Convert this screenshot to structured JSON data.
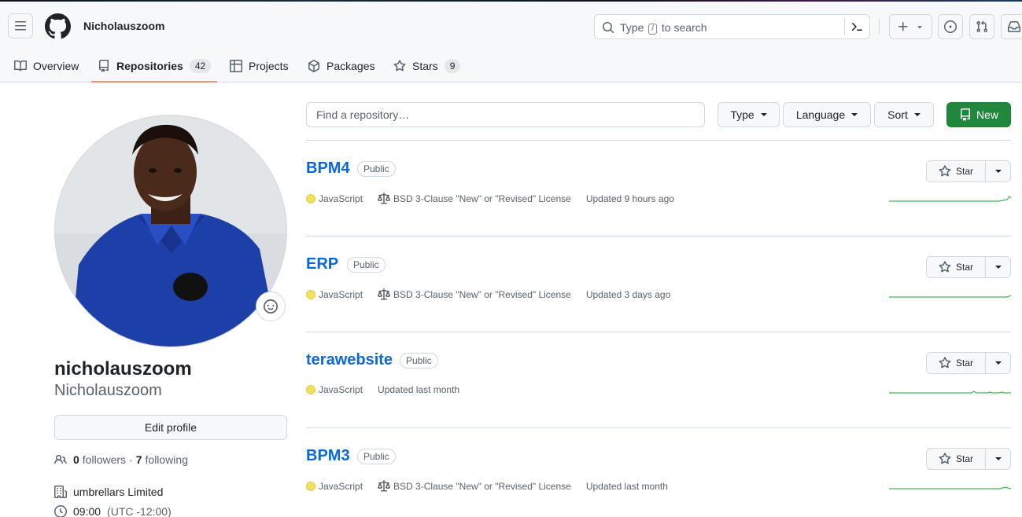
{
  "header": {
    "username": "Nicholauszoom",
    "search_prefix": "Type",
    "search_key": "/",
    "search_suffix": "to search"
  },
  "tabs": [
    {
      "label": "Overview",
      "count": null
    },
    {
      "label": "Repositories",
      "count": "42"
    },
    {
      "label": "Projects",
      "count": null
    },
    {
      "label": "Packages",
      "count": null
    },
    {
      "label": "Stars",
      "count": "9"
    }
  ],
  "profile": {
    "login": "nicholauszoom",
    "name": "Nicholauszoom",
    "edit_label": "Edit profile",
    "followers": "0",
    "followers_label": "followers",
    "separator": "·",
    "following": "7",
    "following_label": "following",
    "company": "umbrellars Limited",
    "local_time": "09:00",
    "timezone": "(UTC -12:00)"
  },
  "toolbar": {
    "find_placeholder": "Find a repository…",
    "type_label": "Type",
    "language_label": "Language",
    "sort_label": "Sort",
    "new_label": "New"
  },
  "repos": [
    {
      "name": "BPM4",
      "visibility": "Public",
      "language": "JavaScript",
      "license": "BSD 3-Clause \"New\" or \"Revised\" License",
      "updated": "Updated 9 hours ago",
      "star_label": "Star"
    },
    {
      "name": "ERP",
      "visibility": "Public",
      "language": "JavaScript",
      "license": "BSD 3-Clause \"New\" or \"Revised\" License",
      "updated": "Updated 3 days ago",
      "star_label": "Star"
    },
    {
      "name": "terawebsite",
      "visibility": "Public",
      "language": "JavaScript",
      "license": "",
      "updated": "Updated last month",
      "star_label": "Star"
    },
    {
      "name": "BPM3",
      "visibility": "Public",
      "language": "JavaScript",
      "license": "BSD 3-Clause \"New\" or \"Revised\" License",
      "updated": "Updated last month",
      "star_label": "Star"
    }
  ],
  "colors": {
    "language_javascript": "#f1e05a",
    "link": "#0969da",
    "primary_button": "#1f883d",
    "active_tab_underline": "#fd8c73",
    "sparkline": "#3fb950"
  }
}
